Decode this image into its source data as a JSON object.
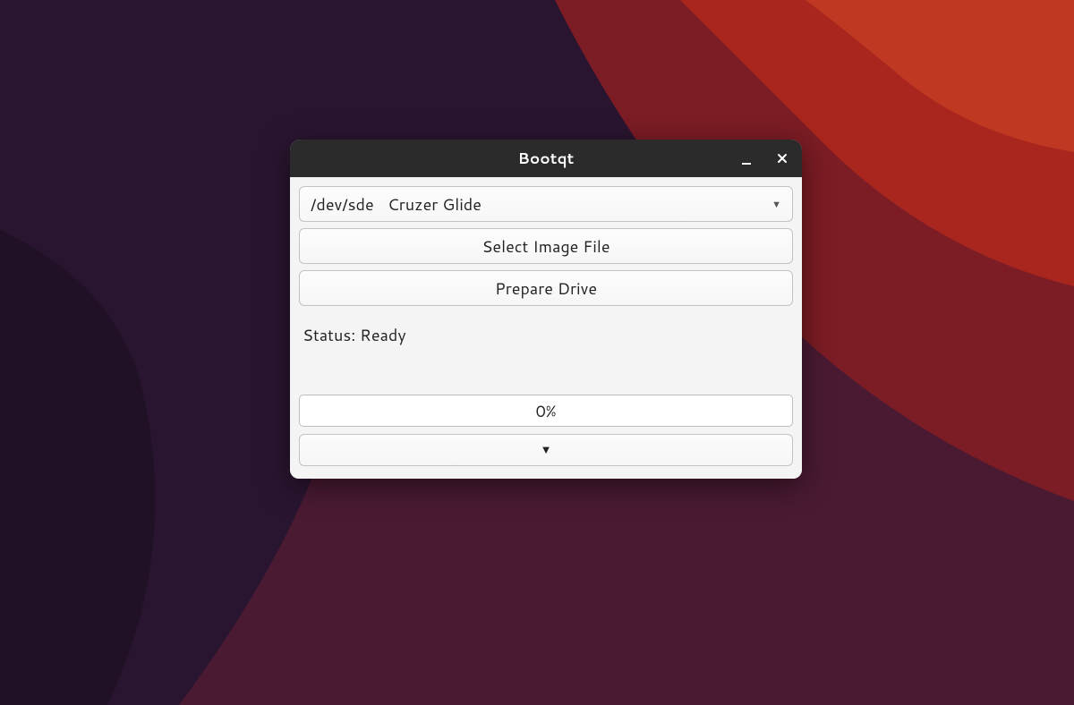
{
  "window": {
    "title": "Bootqt"
  },
  "devices": {
    "selected_path": "/dev/sde",
    "selected_name": "Cruzer Glide"
  },
  "buttons": {
    "select_image": "Select Image File",
    "prepare_drive": "Prepare Drive"
  },
  "status": {
    "text": "Status: Ready"
  },
  "progress": {
    "text": "0%",
    "value": 0
  }
}
